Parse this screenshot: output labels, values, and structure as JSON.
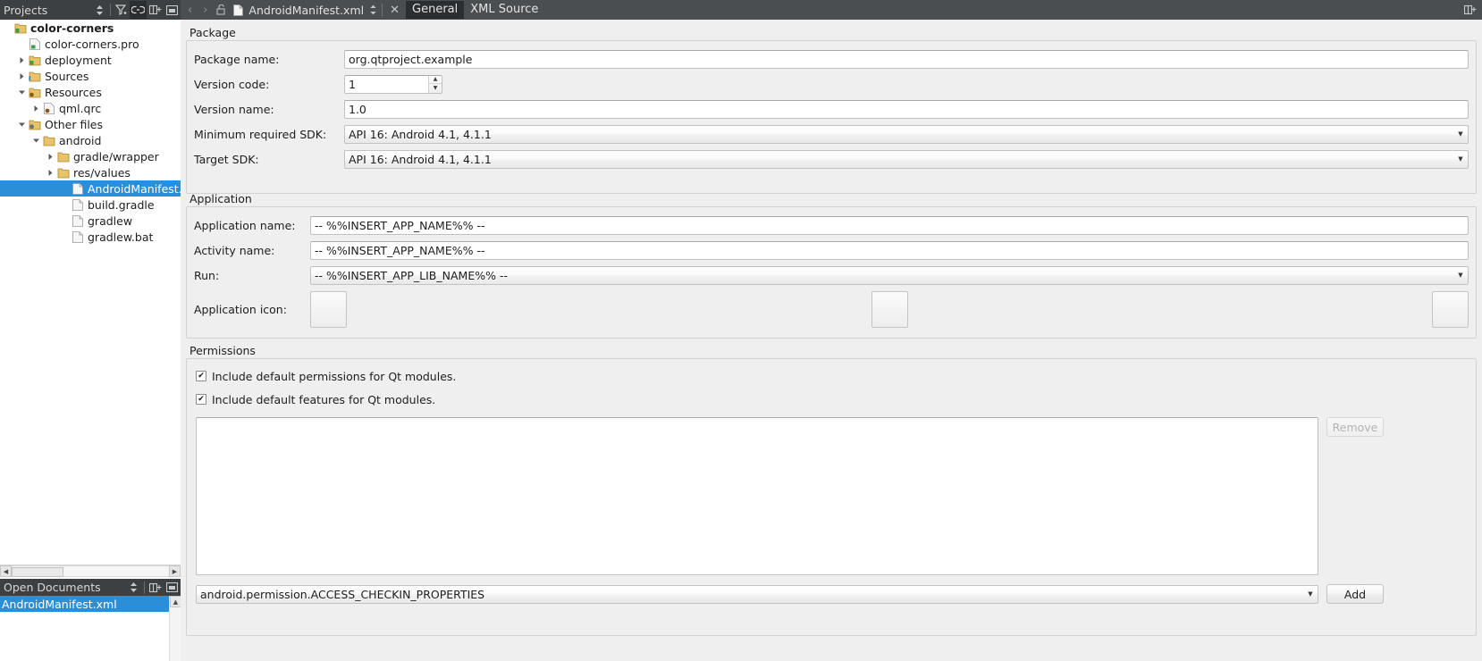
{
  "window": {
    "projects_panel_title": "Projects",
    "open_documents_title": "Open Documents"
  },
  "editor_tabbar": {
    "document_name": "AndroidManifest.xml",
    "tabs": [
      {
        "label": "General",
        "selected": true
      },
      {
        "label": "XML Source",
        "selected": false
      }
    ],
    "close_label": "✕",
    "back_arrow": "‹",
    "forward_arrow": "›"
  },
  "project_tree": {
    "nodes": [
      {
        "label": "color-corners",
        "indent": 0,
        "arrow": "",
        "icon": "project-icon",
        "bold": true,
        "selected": false
      },
      {
        "label": "color-corners.pro",
        "indent": 1,
        "arrow": "",
        "icon": "pro-file-icon",
        "bold": false,
        "selected": false
      },
      {
        "label": "deployment",
        "indent": 1,
        "arrow": "right",
        "icon": "folder-qt-icon",
        "bold": false,
        "selected": false
      },
      {
        "label": "Sources",
        "indent": 1,
        "arrow": "right",
        "icon": "sources-icon",
        "bold": false,
        "selected": false
      },
      {
        "label": "Resources",
        "indent": 1,
        "arrow": "down",
        "icon": "resources-icon",
        "bold": false,
        "selected": false
      },
      {
        "label": "qml.qrc",
        "indent": 2,
        "arrow": "right",
        "icon": "qrc-icon",
        "bold": false,
        "selected": false
      },
      {
        "label": "Other files",
        "indent": 1,
        "arrow": "down",
        "icon": "otherfiles-icon",
        "bold": false,
        "selected": false
      },
      {
        "label": "android",
        "indent": 2,
        "arrow": "down",
        "icon": "folder-icon",
        "bold": false,
        "selected": false
      },
      {
        "label": "gradle/wrapper",
        "indent": 3,
        "arrow": "right",
        "icon": "folder-icon",
        "bold": false,
        "selected": false
      },
      {
        "label": "res/values",
        "indent": 3,
        "arrow": "right",
        "icon": "folder-icon",
        "bold": false,
        "selected": false
      },
      {
        "label": "AndroidManifest.xml",
        "indent": 4,
        "arrow": "",
        "icon": "file-icon",
        "bold": false,
        "selected": true
      },
      {
        "label": "build.gradle",
        "indent": 4,
        "arrow": "",
        "icon": "file-icon",
        "bold": false,
        "selected": false
      },
      {
        "label": "gradlew",
        "indent": 4,
        "arrow": "",
        "icon": "file-icon",
        "bold": false,
        "selected": false
      },
      {
        "label": "gradlew.bat",
        "indent": 4,
        "arrow": "",
        "icon": "file-icon",
        "bold": false,
        "selected": false
      }
    ]
  },
  "open_documents": {
    "items": [
      {
        "label": "AndroidManifest.xml",
        "selected": true
      }
    ]
  },
  "package": {
    "title": "Package",
    "package_name_label": "Package name:",
    "package_name_value": "org.qtproject.example",
    "version_code_label": "Version code:",
    "version_code_value": "1",
    "version_name_label": "Version name:",
    "version_name_value": "1.0",
    "min_sdk_label": "Minimum required SDK:",
    "min_sdk_value": "API 16: Android 4.1, 4.1.1",
    "target_sdk_label": "Target SDK:",
    "target_sdk_value": "API 16: Android 4.1, 4.1.1"
  },
  "application": {
    "title": "Application",
    "app_name_label": "Application name:",
    "app_name_value": "-- %%INSERT_APP_NAME%% --",
    "activity_name_label": "Activity name:",
    "activity_name_value": "-- %%INSERT_APP_NAME%% --",
    "run_label": "Run:",
    "run_value": "-- %%INSERT_APP_LIB_NAME%% --",
    "app_icon_label": "Application icon:"
  },
  "permissions": {
    "title": "Permissions",
    "include_default_permissions_label": "Include default permissions for Qt modules.",
    "include_default_permissions_checked": true,
    "include_default_features_label": "Include default features for Qt modules.",
    "include_default_features_checked": true,
    "permission_list_items": [],
    "remove_button_label": "Remove",
    "remove_button_enabled": false,
    "permission_combo_value": "android.permission.ACCESS_CHECKIN_PROPERTIES",
    "add_button_label": "Add"
  },
  "colors": {
    "selection_blue": "#2a8fd8",
    "toolbar_dark": "#4a4e50",
    "panel_header_dark": "#3c4042",
    "form_background": "#efefef"
  }
}
